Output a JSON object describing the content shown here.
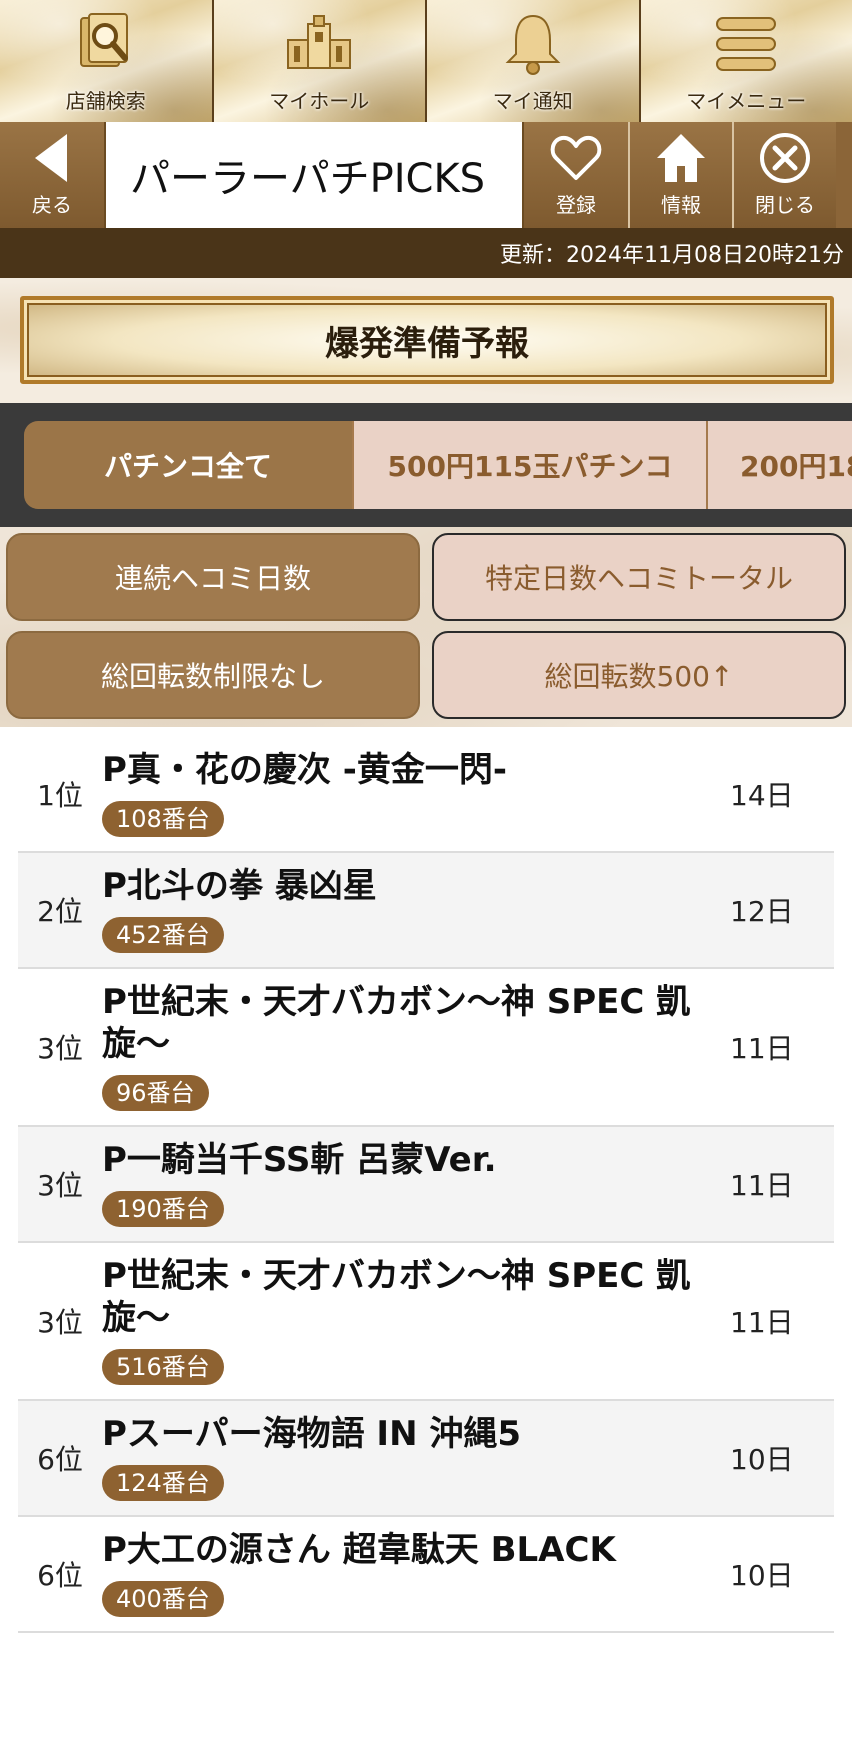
{
  "topnav": [
    {
      "label": "店舗検索",
      "icon": "store-search-icon"
    },
    {
      "label": "マイホール",
      "icon": "hall-building-icon"
    },
    {
      "label": "マイ通知",
      "icon": "bell-icon"
    },
    {
      "label": "マイメニュー",
      "icon": "menu-icon"
    }
  ],
  "header": {
    "back_label": "戻る",
    "title": "パーラーパチPICKS",
    "register_label": "登録",
    "info_label": "情報",
    "close_label": "閉じる"
  },
  "update_text": "更新：2024年11月08日20時21分",
  "banner_text": "爆発準備予報",
  "tabs": [
    {
      "label": "パチンコ全て",
      "active": true
    },
    {
      "label": "500円115玉パチンコ",
      "active": false
    },
    {
      "label": "200円18",
      "active": false
    }
  ],
  "filters": [
    {
      "label": "連続ヘコミ日数",
      "active": true
    },
    {
      "label": "特定日数ヘコミトータル",
      "active": false
    },
    {
      "label": "総回転数制限なし",
      "active": true
    },
    {
      "label": "総回転数500↑",
      "active": false
    }
  ],
  "ranking": [
    {
      "rank": "1位",
      "machine": "P真・花の慶次 -黄金一閃-",
      "unit": "108番台",
      "days": "14日"
    },
    {
      "rank": "2位",
      "machine": "P北斗の拳 暴凶星",
      "unit": "452番台",
      "days": "12日"
    },
    {
      "rank": "3位",
      "machine": "P世紀末・天才バカボン〜神 SPEC 凱旋〜",
      "unit": "96番台",
      "days": "11日"
    },
    {
      "rank": "3位",
      "machine": "P一騎当千SS斬 呂蒙Ver.",
      "unit": "190番台",
      "days": "11日"
    },
    {
      "rank": "3位",
      "machine": "P世紀末・天才バカボン〜神 SPEC 凱旋〜",
      "unit": "516番台",
      "days": "11日"
    },
    {
      "rank": "6位",
      "machine": "Pスーパー海物語 IN 沖縄5",
      "unit": "124番台",
      "days": "10日"
    },
    {
      "rank": "6位",
      "machine": "P大工の源さん 超韋駄天 BLACK",
      "unit": "400番台",
      "days": "10日"
    }
  ],
  "colors": {
    "brown_dark": "#4a3418",
    "brown": "#8b6538",
    "tab_active": "#9b7548",
    "tab_inactive": "#ead2c6",
    "badge": "#8e6231"
  }
}
